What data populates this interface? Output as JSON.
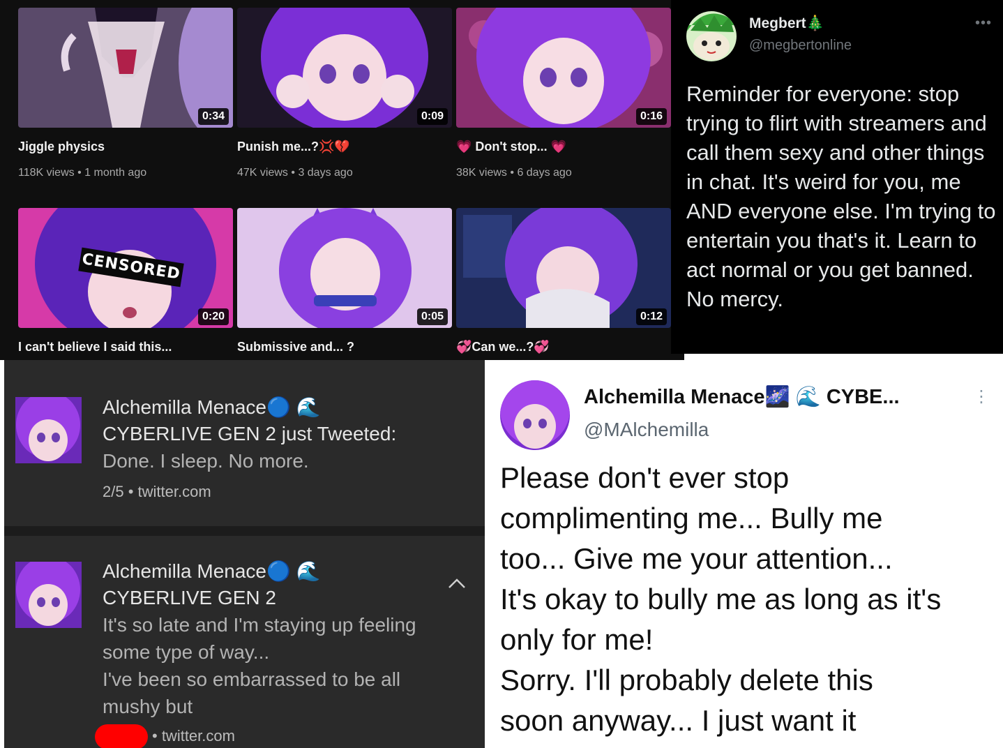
{
  "youtube_grid": {
    "videos": [
      {
        "title": "Jiggle physics",
        "duration": "0:34",
        "views": "118K views",
        "age": "1 month ago"
      },
      {
        "title": "Punish me...?💢💔",
        "duration": "0:09",
        "views": "47K views",
        "age": "3 days ago"
      },
      {
        "title": "💗 Don't stop... 💗",
        "duration": "0:16",
        "views": "38K views",
        "age": "6 days ago"
      },
      {
        "title": "I can't believe I said this...",
        "duration": "0:20",
        "views": "",
        "age": "",
        "overlay_text": "CENSORED"
      },
      {
        "title": "Submissive and... ?",
        "duration": "0:05",
        "views": "",
        "age": ""
      },
      {
        "title": "💞Can we...?💞",
        "duration": "0:12",
        "views": "",
        "age": ""
      }
    ],
    "meta_separator": "•"
  },
  "megbert_tweet": {
    "display_name": "Megbert🎄",
    "handle": "@megbertonline",
    "more_icon": "ellipsis-icon",
    "text": "Reminder for everyone: stop trying to flirt with streamers and call them sexy and other things in chat. It's weird for you, me AND everyone else. I'm trying to entertain you that's it. Learn to act normal or you get banned. No mercy."
  },
  "notifications": [
    {
      "name": "Alchemilla Menace🔵 🌊",
      "line1": "CYBERLIVE GEN 2 just Tweeted:",
      "body_lines": [
        "Done. I sleep. No more."
      ],
      "meta": "2/5 • twitter.com"
    },
    {
      "name": "Alchemilla Menace🔵 🌊",
      "line1": "CYBERLIVE GEN 2",
      "body_lines": [
        "It's so late and I'm staying up feeling",
        "some type of way...",
        "I've been so embarrassed to be all",
        "mushy but"
      ],
      "meta": "• twitter.com",
      "collapse_icon": "chevron-up-icon"
    }
  ],
  "alchemilla_tweet": {
    "display_name": "Alchemilla Menace🌌 🌊 CYBE...",
    "handle": "@MAlchemilla",
    "text_lines": [
      "Please don't ever stop",
      "complimenting me... Bully me",
      "too... Give me your attention...",
      "It's okay to bully me as long as it's",
      "only for me!",
      "Sorry. I'll probably delete this",
      "soon anyway... I just want it"
    ]
  },
  "colors": {
    "youtube_bg": "#0f0f0f",
    "twitter_dark_bg": "#000000",
    "notification_bg": "#2a2a2a",
    "accent_purple": "#8a2be2",
    "redaction_red": "#ff0000"
  }
}
